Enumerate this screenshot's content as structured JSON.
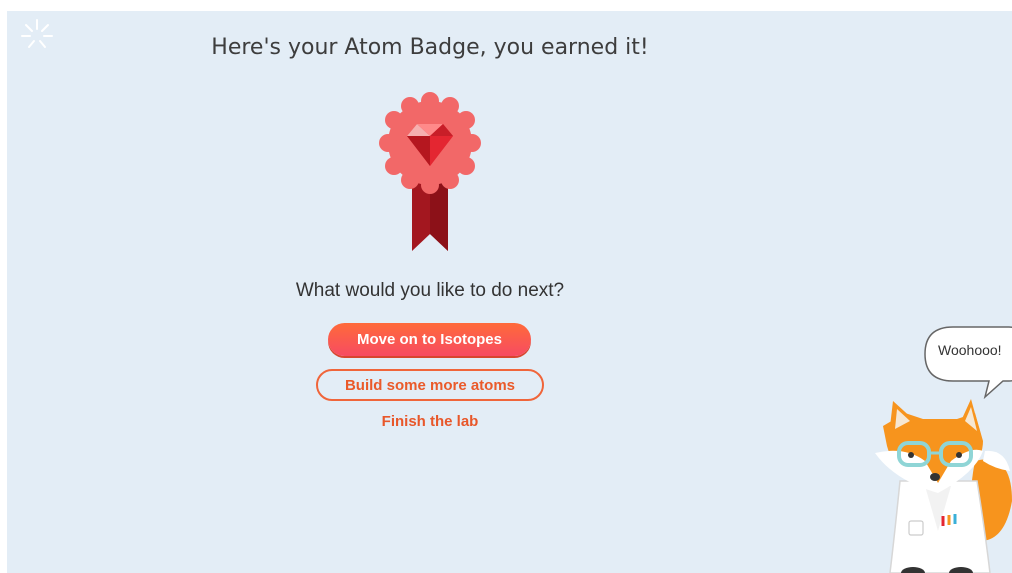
{
  "header": {
    "title": "Here's your Atom Badge, you earned it!"
  },
  "badge": {
    "name": "atom-badge",
    "colors": {
      "rosette": "#f26868",
      "ribbon": "#a3171f",
      "gem": "#e42631"
    }
  },
  "next": {
    "question": "What would you like to do next?",
    "primary_label": "Move on to Isotopes",
    "secondary_label": "Build some more atoms",
    "finish_label": "Finish the lab"
  },
  "mascot": {
    "speech": "Woohooo!"
  },
  "colors": {
    "background": "#e3edf6",
    "accent": "#f0653a",
    "primary_gradient_start": "#ff6a3a",
    "primary_gradient_end": "#f74b62"
  }
}
